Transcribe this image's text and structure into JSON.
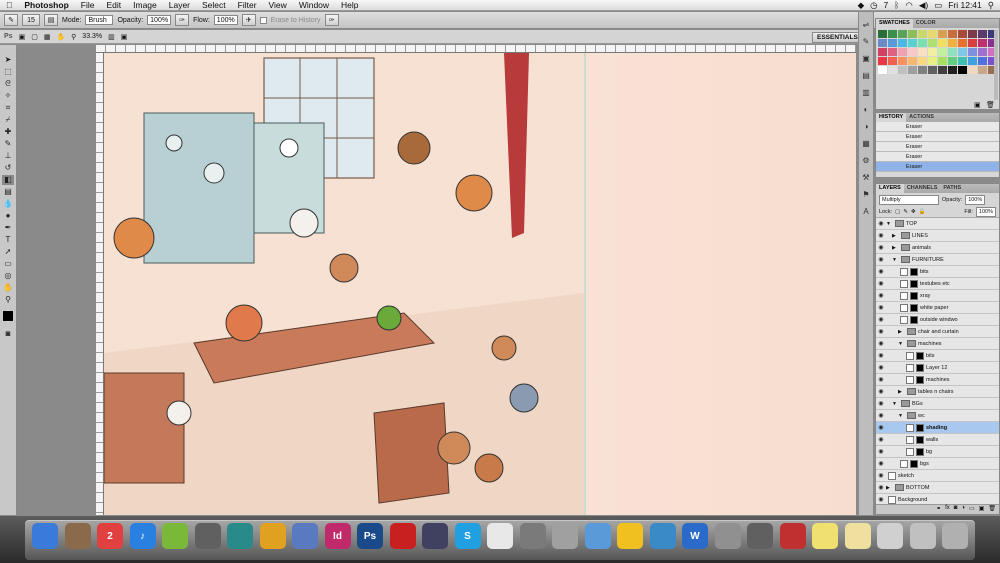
{
  "menubar": {
    "app": "Photoshop",
    "items": [
      "File",
      "Edit",
      "Image",
      "Layer",
      "Select",
      "Filter",
      "View",
      "Window",
      "Help"
    ],
    "clock": "Fri 12:41",
    "battery": "7"
  },
  "options_bar": {
    "mode_label": "Mode:",
    "mode_value": "Brush",
    "opacity_label": "Opacity:",
    "opacity_value": "100%",
    "flow_label": "Flow:",
    "flow_value": "100%",
    "erase_history_label": "Erase to History",
    "brush_size": "15"
  },
  "app_bar": {
    "ps_logo": "Ps",
    "zoom": "33.3%",
    "essentials": "ESSENTIALS"
  },
  "swatches_panel": {
    "tabs": [
      "SWATCHES",
      "COLOR"
    ],
    "colors": [
      "#2a6e3a",
      "#3b8f4a",
      "#5aa45a",
      "#8cbf5a",
      "#c8d86a",
      "#e8d870",
      "#d8a050",
      "#c86e3e",
      "#a84a3a",
      "#7a3a4a",
      "#5a3a6a",
      "#3a3a7a",
      "#6a8ac8",
      "#5a9ad8",
      "#4ab8e0",
      "#5ad0d0",
      "#7ae0b0",
      "#b0e070",
      "#f0e060",
      "#f0b040",
      "#e87030",
      "#d84040",
      "#c03070",
      "#8a3090",
      "#d04060",
      "#e06080",
      "#f0a0b0",
      "#f8c8c8",
      "#f8e0c0",
      "#f0f0a0",
      "#c0f0a0",
      "#90e0c0",
      "#80c8e8",
      "#8090e0",
      "#a070d0",
      "#d070c0",
      "#e83848",
      "#f06050",
      "#f89060",
      "#f8b870",
      "#f8d880",
      "#e8f080",
      "#a8e060",
      "#60d080",
      "#40c0b0",
      "#40a0e0",
      "#5070e0",
      "#7850d0",
      "#ffffff",
      "#e0e0e0",
      "#c0c0c0",
      "#a0a0a0",
      "#808080",
      "#606060",
      "#404040",
      "#202020",
      "#000000",
      "#f0d8c0",
      "#c8a888",
      "#987050"
    ]
  },
  "history_panel": {
    "tabs": [
      "HISTORY",
      "ACTIONS"
    ],
    "items": [
      "Eraser",
      "Eraser",
      "Eraser",
      "Eraser",
      "Eraser"
    ],
    "selected_index": 4
  },
  "layers_panel": {
    "tabs": [
      "LAYERS",
      "CHANNELS",
      "PATHS"
    ],
    "blend_mode": "Multiply",
    "opacity_label": "Opacity:",
    "opacity_value": "100%",
    "lock_label": "Lock:",
    "fill_label": "Fill:",
    "fill_value": "100%",
    "layers": [
      {
        "name": "TOP",
        "type": "group",
        "indent": 0,
        "expanded": true
      },
      {
        "name": "LINES",
        "type": "group",
        "indent": 1,
        "expanded": false
      },
      {
        "name": "animals",
        "type": "group",
        "indent": 1,
        "expanded": false
      },
      {
        "name": "FURNITURE",
        "type": "group",
        "indent": 1,
        "expanded": true
      },
      {
        "name": "bits",
        "type": "layer",
        "indent": 2
      },
      {
        "name": "testubes etc",
        "type": "layer",
        "indent": 2
      },
      {
        "name": "xray",
        "type": "layer",
        "indent": 2
      },
      {
        "name": "white paper",
        "type": "layer",
        "indent": 2
      },
      {
        "name": "outside windwo",
        "type": "layer",
        "indent": 2
      },
      {
        "name": "chair and curtain",
        "type": "group",
        "indent": 2,
        "expanded": false
      },
      {
        "name": "machines",
        "type": "group",
        "indent": 2,
        "expanded": true
      },
      {
        "name": "bits",
        "type": "layer",
        "indent": 3
      },
      {
        "name": "Layer 12",
        "type": "layer",
        "indent": 3
      },
      {
        "name": "machines",
        "type": "layer",
        "indent": 3
      },
      {
        "name": "tables n chairs",
        "type": "group",
        "indent": 2,
        "expanded": false
      },
      {
        "name": "BGs",
        "type": "group",
        "indent": 1,
        "expanded": true
      },
      {
        "name": "wc",
        "type": "group",
        "indent": 2,
        "expanded": true
      },
      {
        "name": "shading",
        "type": "layer",
        "indent": 3,
        "selected": true
      },
      {
        "name": "walls",
        "type": "layer",
        "indent": 3
      },
      {
        "name": "bg",
        "type": "layer",
        "indent": 3
      },
      {
        "name": "bgs",
        "type": "layer",
        "indent": 2
      },
      {
        "name": "sketch",
        "type": "layer",
        "indent": 0
      },
      {
        "name": "BOTTOM",
        "type": "group",
        "indent": 0,
        "expanded": false
      },
      {
        "name": "Background",
        "type": "layer",
        "indent": 0
      }
    ]
  },
  "dock": {
    "icons": [
      {
        "name": "finder",
        "label": "",
        "color": "#3a7ad8"
      },
      {
        "name": "preview",
        "label": "",
        "color": "#8a6a4a"
      },
      {
        "name": "calendar",
        "label": "2",
        "color": "#e04040"
      },
      {
        "name": "itunes",
        "label": "♪",
        "color": "#2a80e0"
      },
      {
        "name": "spotify",
        "label": "",
        "color": "#7ab83a"
      },
      {
        "name": "image-capture",
        "label": "",
        "color": "#606060"
      },
      {
        "name": "time-machine",
        "label": "",
        "color": "#2a8a8a"
      },
      {
        "name": "chrome",
        "label": "",
        "color": "#e0a020"
      },
      {
        "name": "iphoto",
        "label": "",
        "color": "#5a7ac0"
      },
      {
        "name": "indesign",
        "label": "Id",
        "color": "#c02a6a"
      },
      {
        "name": "photoshop",
        "label": "Ps",
        "color": "#1a4a8a"
      },
      {
        "name": "acrobat",
        "label": "",
        "color": "#c82020"
      },
      {
        "name": "pen-tool",
        "label": "",
        "color": "#404060"
      },
      {
        "name": "skype",
        "label": "S",
        "color": "#20a0e0"
      },
      {
        "name": "text-document",
        "label": "",
        "color": "#e8e8e8"
      },
      {
        "name": "system-preferences",
        "label": "",
        "color": "#7a7a7a"
      },
      {
        "name": "calculator",
        "label": "",
        "color": "#a0a0a0"
      },
      {
        "name": "file-stack",
        "label": "",
        "color": "#5a9ad8"
      },
      {
        "name": "rubber-duck",
        "label": "",
        "color": "#f0c020"
      },
      {
        "name": "wacom",
        "label": "",
        "color": "#3a8ac8"
      },
      {
        "name": "word",
        "label": "W",
        "color": "#2a6ac8"
      },
      {
        "name": "automator",
        "label": "",
        "color": "#909090"
      },
      {
        "name": "printer",
        "label": "",
        "color": "#606060"
      },
      {
        "name": "image-viewer",
        "label": "",
        "color": "#c03030"
      },
      {
        "name": "stickies",
        "label": "",
        "color": "#f0e070"
      },
      {
        "name": "notes",
        "label": "",
        "color": "#f0e0a0"
      },
      {
        "name": "documents-stack",
        "label": "",
        "color": "#d0d0d0"
      },
      {
        "name": "downloads-stack",
        "label": "",
        "color": "#c0c0c0"
      },
      {
        "name": "trash",
        "label": "",
        "color": "#b0b0b0"
      }
    ]
  }
}
